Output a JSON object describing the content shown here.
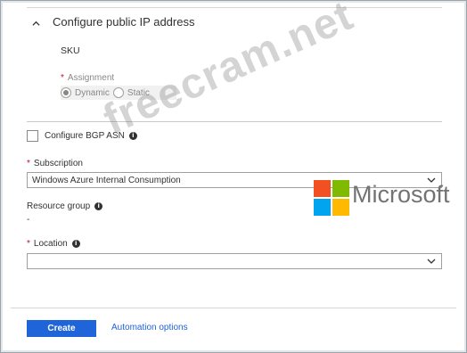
{
  "section": {
    "title": "Configure public IP address"
  },
  "sku": {
    "label": "SKU"
  },
  "assignment": {
    "required_mark": "*",
    "label": "Assignment",
    "options": [
      {
        "label": "Dynamic",
        "selected": true
      },
      {
        "label": "Static",
        "selected": false
      }
    ]
  },
  "bgp": {
    "label": "Configure BGP ASN",
    "checked": false,
    "info_icon": "info-icon"
  },
  "subscription": {
    "required_mark": "*",
    "label": "Subscription",
    "value": "Windows Azure Internal Consumption"
  },
  "resource_group": {
    "label": "Resource group",
    "value": "-"
  },
  "location": {
    "required_mark": "*",
    "label": "Location",
    "value": ""
  },
  "footer": {
    "create_label": "Create",
    "automation_label": "Automation options"
  },
  "watermark": {
    "text": "freecram.net"
  },
  "logo": {
    "text": "Microsoft",
    "colors": [
      "#f25022",
      "#7fba00",
      "#00a4ef",
      "#ffb900"
    ]
  },
  "colors": {
    "accent": "#1f64d8",
    "required": "#c50f1f"
  }
}
